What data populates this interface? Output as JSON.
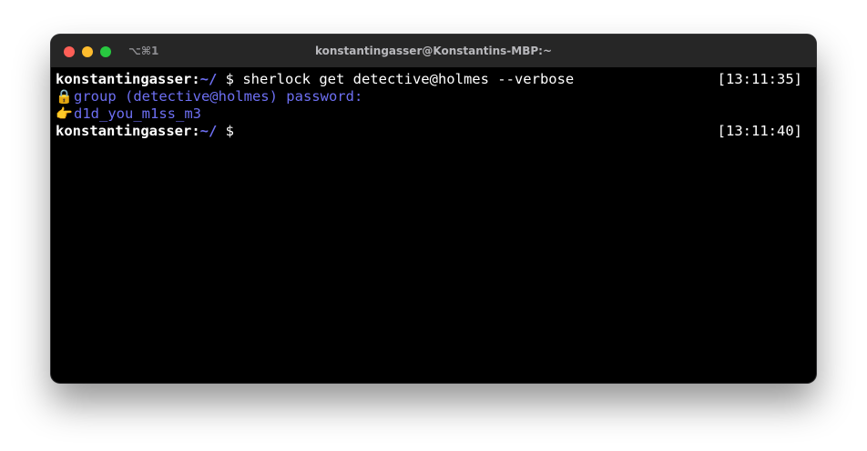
{
  "window": {
    "title": "konstantingasser@Konstantins-MBP:~",
    "shortcut": "⌥⌘1"
  },
  "icons": [
    "close-button-red",
    "minimize-button-yellow",
    "zoom-button-green",
    "lock-icon",
    "pointing-hand-icon"
  ],
  "colors": {
    "background": "#000000",
    "titlebar": "#262626",
    "prompt_path": "#6d6ff2",
    "output_text": "#6d6ff2",
    "text": "#ffffff"
  },
  "terminal": {
    "lines": [
      {
        "user": "konstantingasser",
        "colon": ":",
        "path": "~/",
        "prompt": " $ ",
        "command": "sherlock get detective@holmes --verbose",
        "timestamp": "[13:11:35]"
      },
      {
        "icon": "🔒",
        "text": "group (detective@holmes) password:"
      },
      {
        "icon": "👉",
        "text": "d1d_you_m1ss_m3"
      },
      {
        "user": "konstantingasser",
        "colon": ":",
        "path": "~/",
        "prompt": " $",
        "command": "",
        "timestamp": "[13:11:40]"
      }
    ]
  }
}
